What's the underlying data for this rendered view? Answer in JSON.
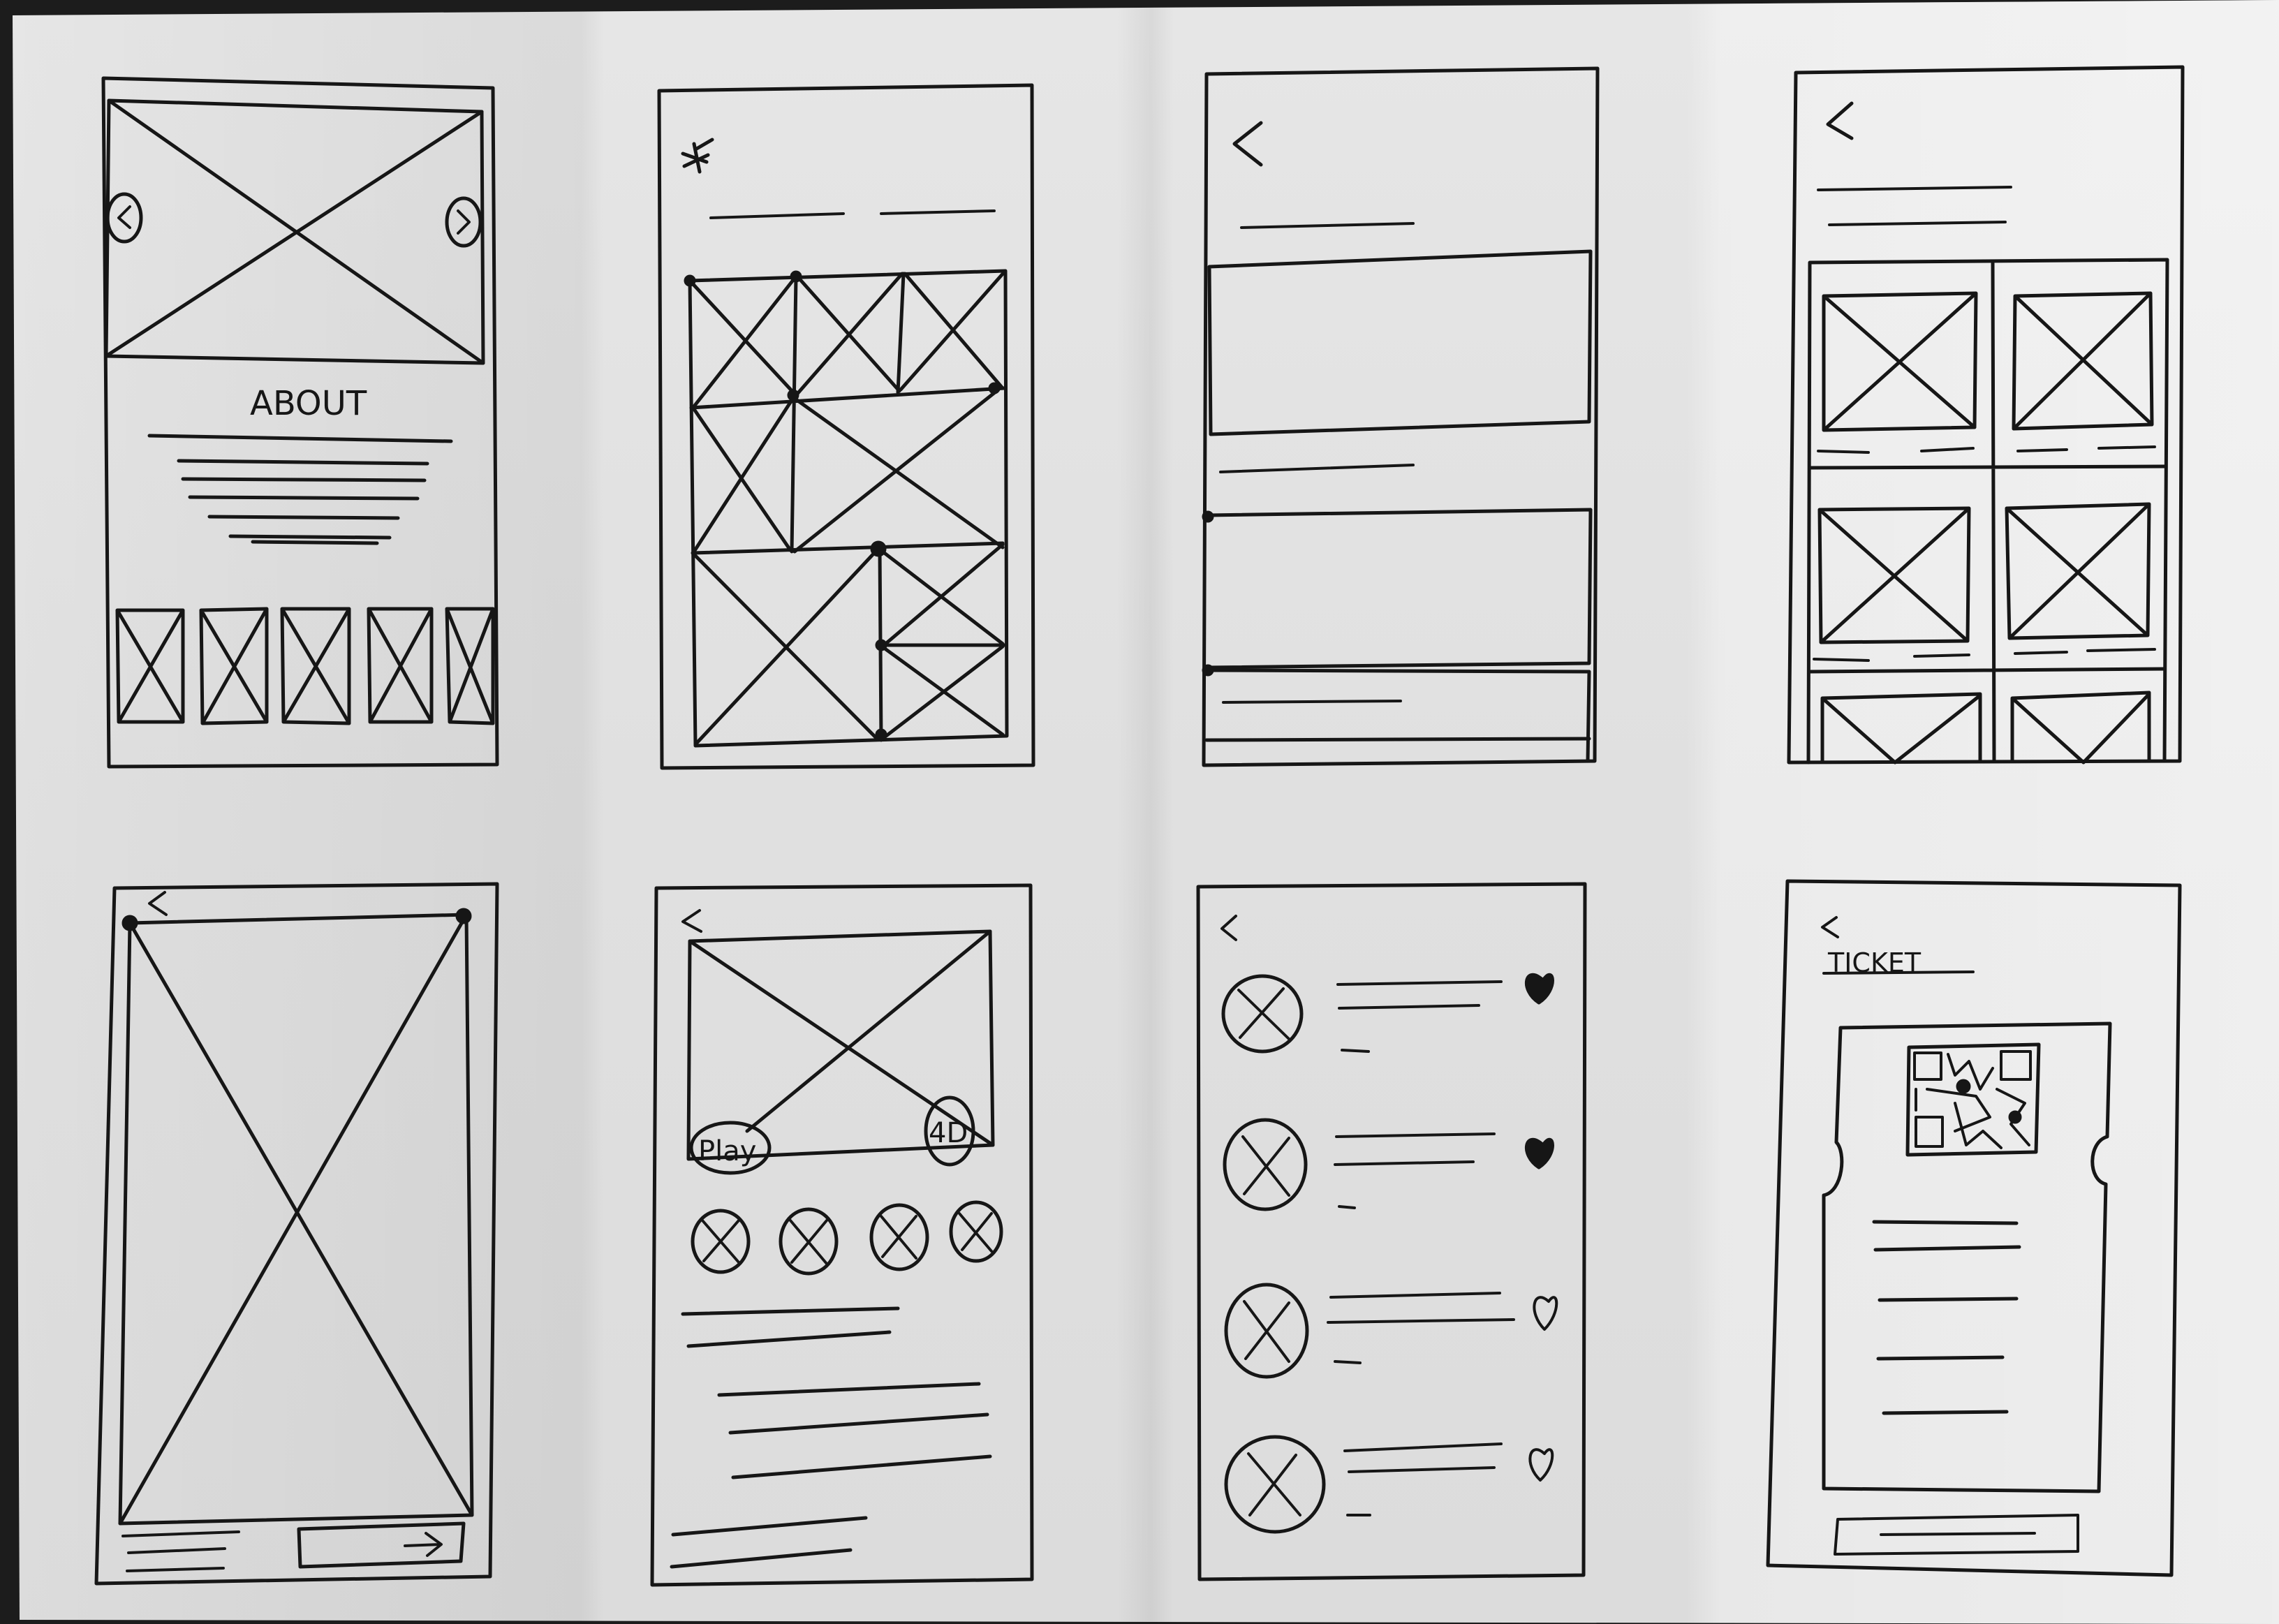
{
  "screens": {
    "about": {
      "heading": "ABOUT"
    },
    "video": {
      "play_label": "Play",
      "hd_label": "4D"
    },
    "ticket": {
      "title": "TICKET"
    }
  },
  "icons": [
    "back-arrow-icon",
    "chevron-left-icon",
    "chevron-right-icon",
    "next-arrow-icon",
    "heart-filled-icon",
    "heart-outline-icon",
    "qr-code-icon",
    "logo-icon"
  ],
  "colors": {
    "paper": "#e3e3e3",
    "ink": "#161616",
    "background": "#1c1c1c"
  }
}
